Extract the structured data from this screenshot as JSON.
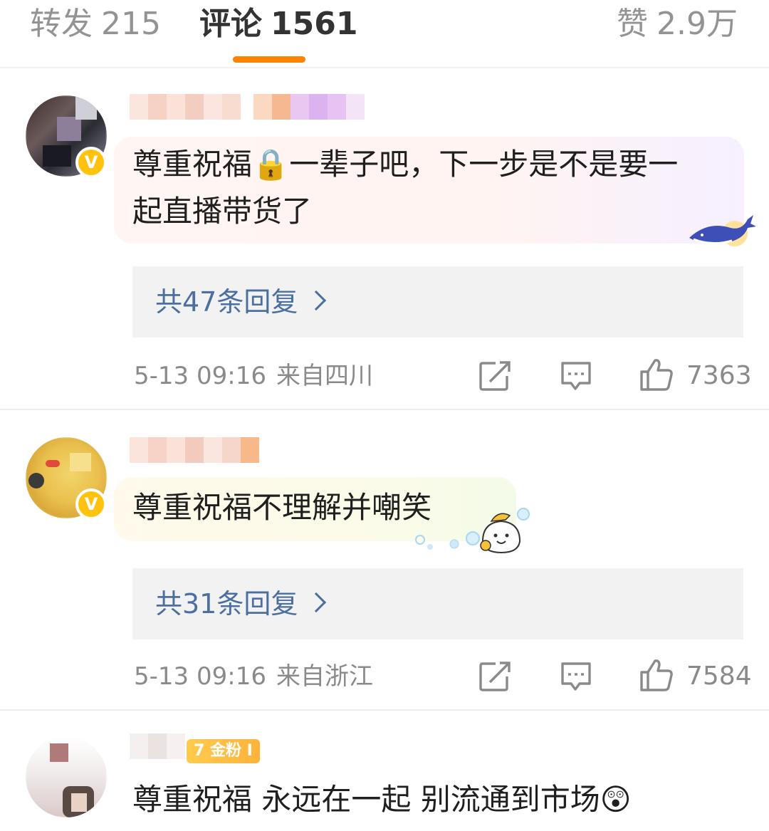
{
  "tabs": {
    "reposts": {
      "label": "转发",
      "count": "215"
    },
    "comments": {
      "label": "评论",
      "count": "1561"
    },
    "likes": {
      "label": "赞",
      "count": "2.9万"
    }
  },
  "comments": [
    {
      "text_line1": "尊重祝福🔒一辈子吧，下一步是不是要一",
      "text_line2": "起直播带货了",
      "replies_label": "共47条回复",
      "date": "5-13 09:16",
      "location": "来自四川",
      "likes": "7363",
      "verified_mark": "V",
      "bubble_colors": [
        "#fff3ef",
        "#f3f0ff"
      ]
    },
    {
      "text_line1": "尊重祝福不理解并嘲笑",
      "replies_label": "共31条回复",
      "date": "5-13 09:16",
      "location": "来自浙江",
      "likes": "7584",
      "verified_mark": "V",
      "bubble_colors": [
        "#fff9e8",
        "#f4fbe8"
      ]
    },
    {
      "badge_text": "7 金粉 I",
      "text_line1": "尊重祝福 永远在一起 别流通到市场",
      "emoji": "😲"
    }
  ],
  "icons": [
    "repost-icon",
    "comment-icon",
    "like-icon",
    "lock-emoji",
    "whale-sticker",
    "cartoon-sticker",
    "surprised-emoji"
  ],
  "colors": {
    "accent": "#ff8200",
    "link": "#4a6fa0",
    "verified": "#ffc20e"
  }
}
